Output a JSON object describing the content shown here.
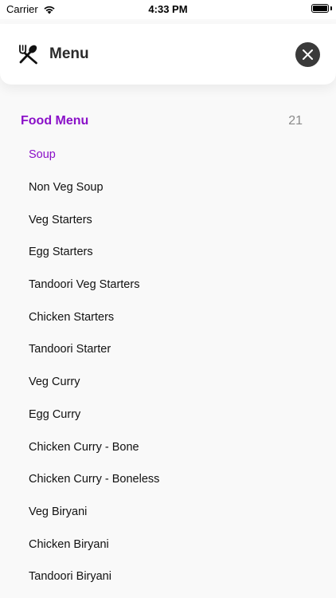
{
  "status_bar": {
    "carrier": "Carrier",
    "time": "4:33 PM",
    "wifi_icon": "wifi-icon",
    "battery_icon": "battery-icon",
    "battery_level": 1.0
  },
  "header": {
    "icon": "utensils-icon",
    "title": "Menu",
    "close_icon": "close-icon"
  },
  "menu": {
    "section_title": "Food Menu",
    "count": "21",
    "active_color": "#8a10c8",
    "items": [
      {
        "label": "Soup",
        "active": true
      },
      {
        "label": "Non Veg Soup",
        "active": false
      },
      {
        "label": "Veg Starters",
        "active": false
      },
      {
        "label": "Egg Starters",
        "active": false
      },
      {
        "label": "Tandoori Veg Starters",
        "active": false
      },
      {
        "label": "Chicken Starters",
        "active": false
      },
      {
        "label": "Tandoori Starter",
        "active": false
      },
      {
        "label": "Veg Curry",
        "active": false
      },
      {
        "label": "Egg Curry",
        "active": false
      },
      {
        "label": "Chicken Curry - Bone",
        "active": false
      },
      {
        "label": "Chicken Curry - Boneless",
        "active": false
      },
      {
        "label": "Veg Biryani",
        "active": false
      },
      {
        "label": "Chicken Biryani",
        "active": false
      },
      {
        "label": "Tandoori Biryani",
        "active": false
      }
    ]
  }
}
